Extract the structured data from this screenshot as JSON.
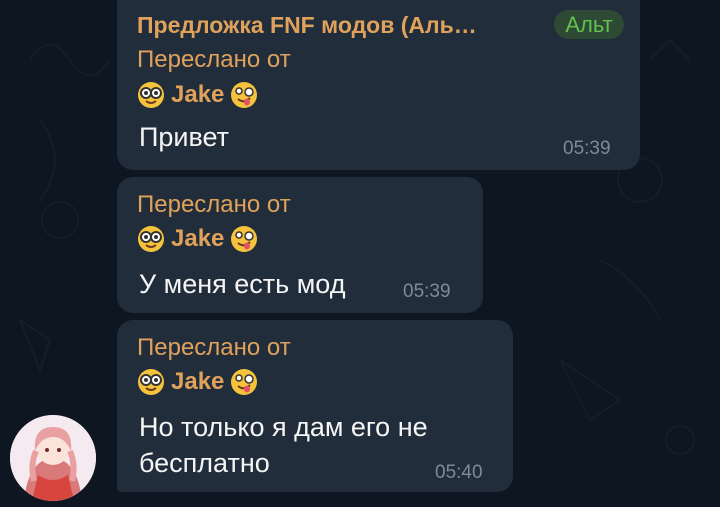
{
  "messages": [
    {
      "channel": "Предложка FNF модов (Аль…",
      "badge": "Альт",
      "forwarded_label": "Переслано от",
      "forwarded_name": "Jake",
      "text": "Привет",
      "time": "05:39"
    },
    {
      "forwarded_label": "Переслано от",
      "forwarded_name": "Jake",
      "text": "У меня есть мод",
      "time": "05:39"
    },
    {
      "forwarded_label": "Переслано от",
      "forwarded_name": "Jake",
      "text_line1": "Но только я дам его не",
      "text_line2": "бесплатно",
      "time": "05:40"
    }
  ],
  "colors": {
    "background": "#0e1621",
    "bubble": "#212d3b",
    "accent": "#e0a25a",
    "badge_text": "#5fc24f",
    "time": "#7c8b99"
  }
}
